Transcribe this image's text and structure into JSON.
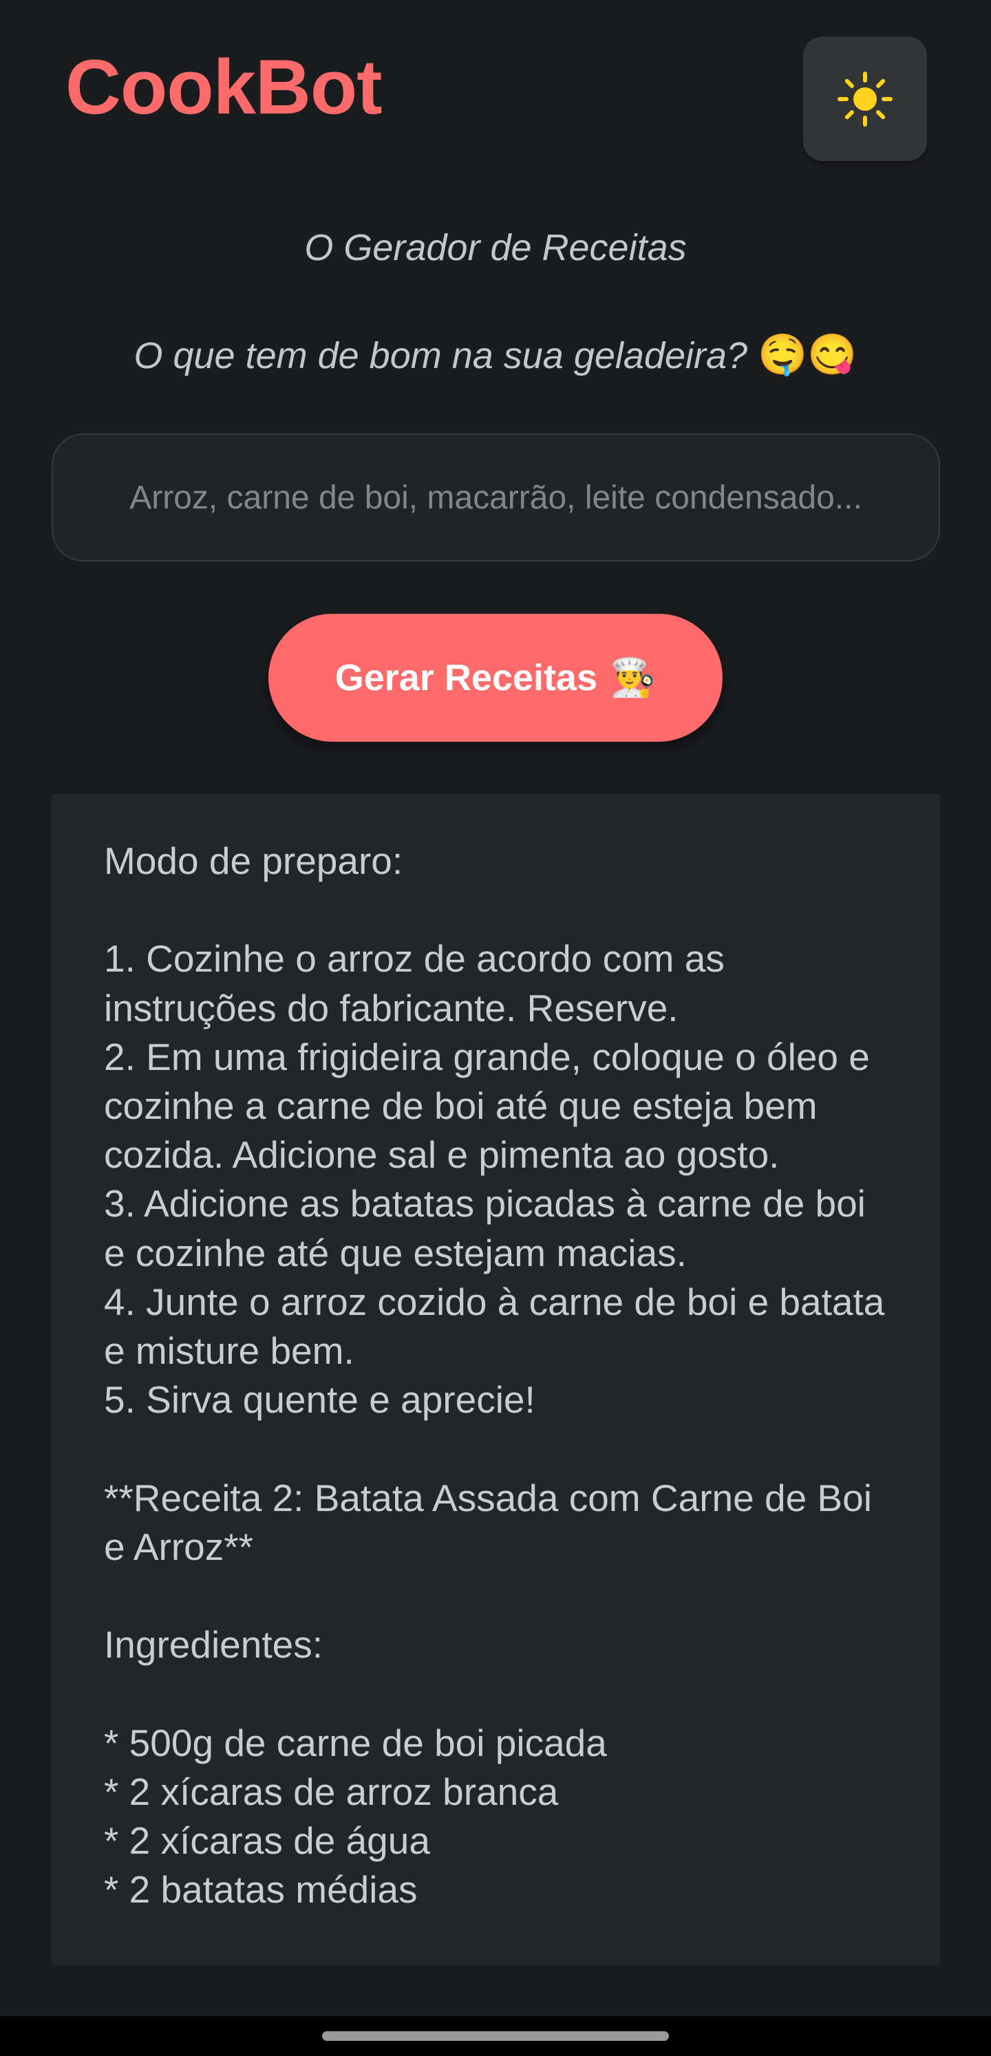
{
  "app": {
    "title": "CookBot",
    "theme_toggle_icon": "sun-icon"
  },
  "hero": {
    "subtitle": "O Gerador de Receitas",
    "question": "O que tem de bom na sua geladeira?",
    "question_emojis": "🤤😋"
  },
  "search": {
    "placeholder": "Arroz, carne de boi, macarrão, leite condensado...",
    "value": ""
  },
  "generate_button": {
    "label": "Gerar Receitas",
    "emoji": "👨‍🍳"
  },
  "recipe": {
    "text": "Modo de preparo:\n\n1. Cozinhe o arroz de acordo com as instruções do fabricante. Reserve.\n2. Em uma frigideira grande, coloque o óleo e cozinhe a carne de boi até que esteja bem cozida. Adicione sal e pimenta ao gosto.\n3. Adicione as batatas picadas à carne de boi e cozinhe até que estejam macias.\n4. Junte o arroz cozido à carne de boi e batata e misture bem.\n5. Sirva quente e aprecie!\n\n**Receita 2: Batata Assada com Carne de Boi e Arroz**\n\nIngredientes:\n\n* 500g de carne de boi picada\n* 2 xícaras de arroz branca\n* 2 xícaras de água\n* 2 batatas médias"
  },
  "colors": {
    "accent": "#ff6b6b",
    "background": "#1b1c1e",
    "panel": "#242527",
    "sun": "#ffd21f"
  }
}
